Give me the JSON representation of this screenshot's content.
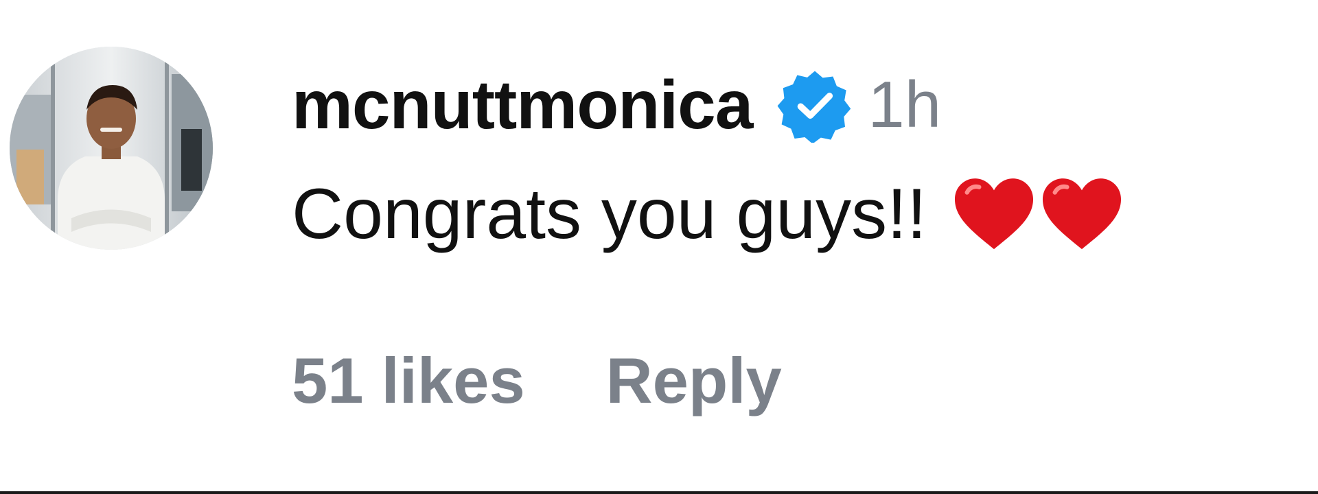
{
  "comment": {
    "avatar_icon": "profile-photo",
    "username": "mcnuttmonica",
    "verified_icon": "verified-badge-icon",
    "verified_color": "#1d9bf0",
    "time": "1h",
    "text": "Congrats you guys!!",
    "emoji": [
      "red-heart-icon",
      "red-heart-icon"
    ],
    "likes": "51 likes",
    "reply_label": "Reply"
  },
  "colors": {
    "text": "#111111",
    "muted": "#7b818a",
    "heart": "#e0141e"
  }
}
